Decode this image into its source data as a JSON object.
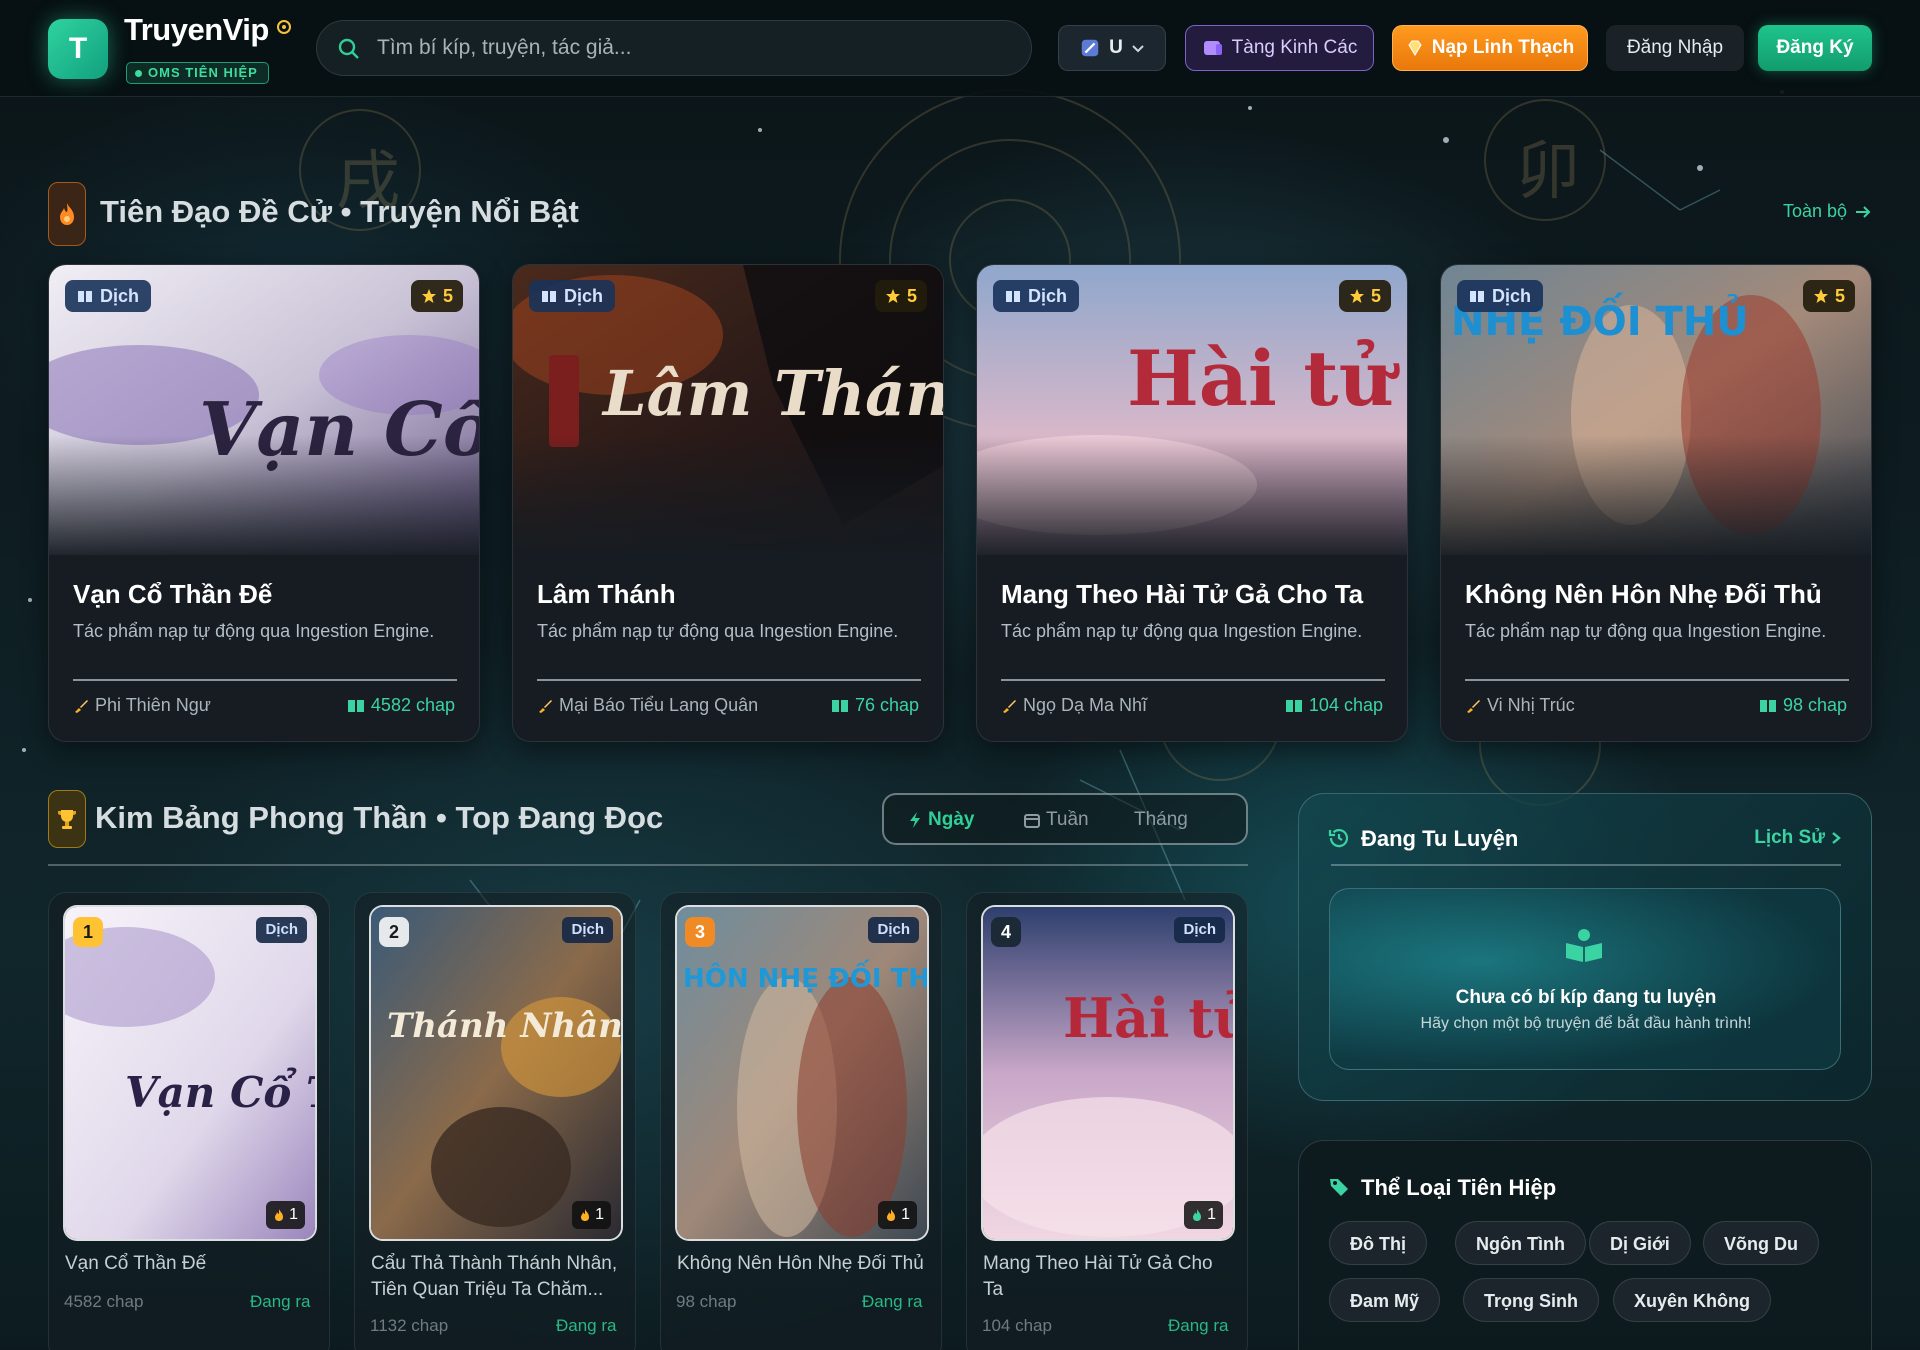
{
  "header": {
    "logo_letter": "T",
    "brand": "TruyenVip",
    "badge": "OMS TIÊN HIỆP",
    "search_placeholder": "Tìm bí kíp, truyện, tác giả...",
    "lang_label": "U",
    "tang_kinh_cac": "Tàng Kinh Các",
    "nap_linh_thach": "Nạp Linh Thạch",
    "login": "Đăng Nhập",
    "register": "Đăng Ký"
  },
  "featured": {
    "title": "Tiên Đạo Đề Cử • Truyện Nổi Bật",
    "view_all": "Toàn bộ",
    "cards": [
      {
        "tag": "Dịch",
        "rating": "5",
        "title": "Vạn Cổ Thần Đế",
        "description": "Tác phẩm nạp tự động qua Ingestion Engine.",
        "author": "Phi Thiên Ngư",
        "chapters": "4582 chap",
        "cover_text": "Vạn Cổ"
      },
      {
        "tag": "Dịch",
        "rating": "5",
        "title": "Lâm Thánh",
        "description": "Tác phẩm nạp tự động qua Ingestion Engine.",
        "author": "Mại Báo Tiểu Lang Quân",
        "chapters": "76 chap",
        "cover_text": "Lâm Thánh"
      },
      {
        "tag": "Dịch",
        "rating": "5",
        "title": "Mang Theo Hài Tử Gả Cho Ta",
        "description": "Tác phẩm nạp tự động qua Ingestion Engine.",
        "author": "Ngọ Dạ Ma Nhĩ",
        "chapters": "104 chap",
        "cover_text": "Hài tử"
      },
      {
        "tag": "Dịch",
        "rating": "5",
        "title": "Không Nên Hôn Nhẹ Đối Thủ",
        "description": "Tác phẩm nạp tự động qua Ingestion Engine.",
        "author": "Vi Nhị Trúc",
        "chapters": "98 chap",
        "cover_text": "NHẸ ĐỐI THỦ"
      }
    ]
  },
  "ranking": {
    "title": "Kim Bảng Phong Thần • Top Đang Đọc",
    "tabs": [
      "Ngày",
      "Tuần",
      "Tháng"
    ],
    "active_tab": "Ngày",
    "items": [
      {
        "rank": "1",
        "tag": "Dịch",
        "views": "1",
        "title": "Vạn Cổ Thần Đế",
        "chapters": "4582 chap",
        "status": "Đang ra",
        "cover_text": "Vạn Cổ Thần Đế"
      },
      {
        "rank": "2",
        "tag": "Dịch",
        "views": "1",
        "title": "Cẩu Thả Thành Thánh Nhân, Tiên Quan Triệu Ta Chăm...",
        "chapters": "1132 chap",
        "status": "Đang ra",
        "cover_text": "Thánh Nhân"
      },
      {
        "rank": "3",
        "tag": "Dịch",
        "views": "1",
        "title": "Không Nên Hôn Nhẹ Đối Thủ",
        "chapters": "98 chap",
        "status": "Đang ra",
        "cover_text": "HÔN NHẸ ĐỐI THỦ"
      },
      {
        "rank": "4",
        "tag": "Dịch",
        "views": "1",
        "title": "Mang Theo Hài Tử Gả Cho Ta",
        "chapters": "104 chap",
        "status": "Đang ra",
        "cover_text": "Hài tử"
      }
    ]
  },
  "training": {
    "title": "Đang Tu Luyện",
    "history_link": "Lịch Sử",
    "empty_title": "Chưa có bí kíp đang tu luyện",
    "empty_subtitle": "Hãy chọn một bộ truyện để bắt đầu hành trình!"
  },
  "genres": {
    "title": "Thể Loại Tiên Hiệp",
    "items": [
      "Đô Thị",
      "Ngôn Tình",
      "Dị Giới",
      "Võng Du",
      "Đam Mỹ",
      "Trọng Sinh",
      "Xuyên Không"
    ]
  },
  "colors": {
    "accent": "#3bd3a2",
    "nap_button": "#f08a12",
    "star": "#ffcd3a"
  }
}
